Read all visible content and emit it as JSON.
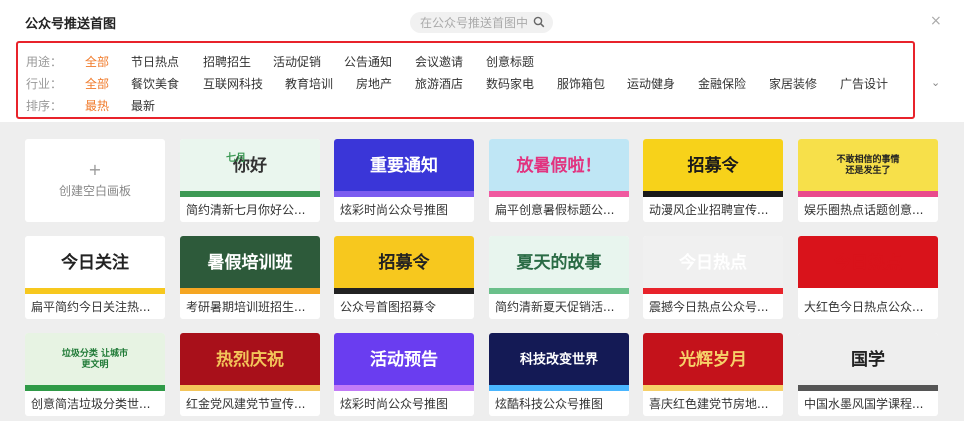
{
  "header": {
    "title": "公众号推送首图",
    "search_placeholder": "在公众号推送首图中",
    "close_symbol": "×"
  },
  "filters": {
    "usage": {
      "label": "用途：",
      "options": [
        "全部",
        "节日热点",
        "招聘招生",
        "活动促销",
        "公告通知",
        "会议邀请",
        "创意标题"
      ],
      "selected": "全部"
    },
    "industry": {
      "label": "行业：",
      "options": [
        "全部",
        "餐饮美食",
        "互联网科技",
        "教育培训",
        "房地产",
        "旅游酒店",
        "数码家电",
        "服饰箱包",
        "运动健身",
        "金融保险",
        "家居装修",
        "广告设计"
      ],
      "selected": "全部"
    },
    "sort": {
      "label": "排序：",
      "options": [
        "最热",
        "最新"
      ],
      "selected": "最热"
    },
    "expand_symbol": "⌄",
    "highlight_color": "#e8232b",
    "active_color": "#f07a2a"
  },
  "gallery": {
    "blank": {
      "plus": "+",
      "label": "创建空白画板"
    },
    "templates": [
      {
        "caption": "简约清新七月你好公...",
        "thumb_text": "你好",
        "thumb_sub": "七月",
        "bg": "#eaf6ee",
        "accent": "#3d9a55",
        "text_color": "#333333"
      },
      {
        "caption": "炫彩时尚公众号推图",
        "thumb_text": "重要通知",
        "bg": "#3a36d8",
        "accent": "#7b5cf0",
        "text_color": "#ffffff"
      },
      {
        "caption": "扁平创意暑假标题公...",
        "thumb_text": "放暑假啦！",
        "bg": "#bfe6f5",
        "accent": "#f05aa0",
        "text_color": "#e2337f"
      },
      {
        "caption": "动漫风企业招聘宣传...",
        "thumb_text": "招募令",
        "bg": "#f7d21a",
        "accent": "#1a1a1a",
        "text_color": "#1a1a1a"
      },
      {
        "caption": "娱乐圈热点话题创意...",
        "thumb_text": "不敢相信的事情还是发生了",
        "bg": "#f7e04a",
        "accent": "#e94a8c",
        "text_color": "#222222"
      },
      {
        "caption": "扁平简约今日关注热...",
        "thumb_text": "今日关注",
        "bg": "#ffffff",
        "accent": "#f7c81e",
        "text_color": "#222222"
      },
      {
        "caption": "考研暑期培训班招生...",
        "thumb_text": "暑假培训班",
        "bg": "#2d5a3a",
        "accent": "#f5a623",
        "text_color": "#ffffff"
      },
      {
        "caption": "公众号首图招募令",
        "thumb_text": "招募令",
        "bg": "#f7c81e",
        "accent": "#222222",
        "text_color": "#222222"
      },
      {
        "caption": "简约清新夏天促销活...",
        "thumb_text": "夏天的故事",
        "bg": "#e8f5ee",
        "accent": "#6ac08a",
        "text_color": "#2a6b45"
      },
      {
        "caption": "震撼今日热点公众号...",
        "thumb_text": "今日热点",
        "bg": "#f0f0f0",
        "accent": "#e8232b",
        "text_color": "#ffffff"
      },
      {
        "caption": "大红色今日热点公众...",
        "thumb_text": "今日热点",
        "bg": "#d9131b",
        "accent": "#ffffff",
        "text_color": "#d9131b"
      },
      {
        "caption": "创意简洁垃圾分类世...",
        "thumb_text": "垃圾分类 让城市更文明",
        "bg": "#e7f3e3",
        "accent": "#2f9a47",
        "text_color": "#1f7a36"
      },
      {
        "caption": "红金党风建党节宣传...",
        "thumb_text": "热烈庆祝",
        "bg": "#a8101a",
        "accent": "#f3c55a",
        "text_color": "#f3c55a"
      },
      {
        "caption": "炫彩时尚公众号推图",
        "thumb_text": "活动预告",
        "bg": "#6a3df0",
        "accent": "#c27bf7",
        "text_color": "#ffffff"
      },
      {
        "caption": "炫酷科技公众号推图",
        "thumb_text": "科技改变世界",
        "bg": "#141a55",
        "accent": "#4ab6ff",
        "text_color": "#ffffff"
      },
      {
        "caption": "喜庆红色建党节房地...",
        "thumb_text": "光辉岁月",
        "bg": "#c4121b",
        "accent": "#f6d068",
        "text_color": "#f6d068"
      },
      {
        "caption": "中国水墨风国学课程...",
        "thumb_text": "国学",
        "bg": "#eeeeee",
        "accent": "#555555",
        "text_color": "#222222"
      }
    ]
  }
}
